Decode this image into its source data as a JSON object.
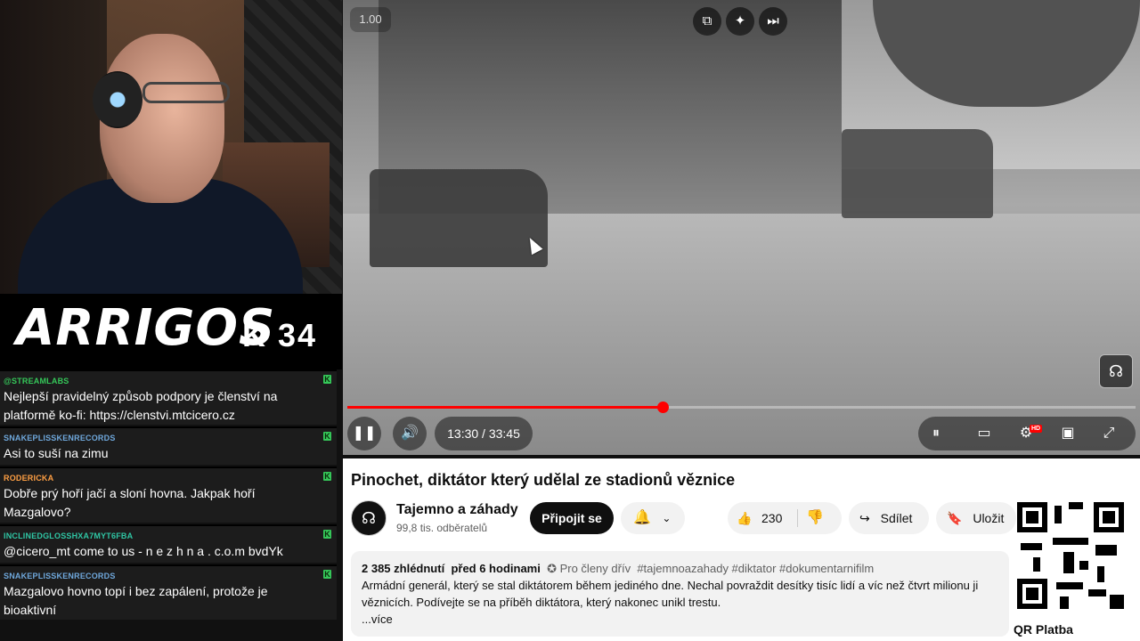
{
  "stream": {
    "brand_logo": "ARRIGOS",
    "brand_code": "K 34"
  },
  "chat": [
    {
      "user": "@STREAMLABS",
      "user_color": "#35c759",
      "text": "Nejlepší pravidelný způsob podpory je členství na platformě ko-fi: https://clenstvi.mtcicero.cz"
    },
    {
      "user": "SNAKEPLISSKENRECORDS",
      "user_color": "#6fa8dc",
      "text": "Asi to suší na zimu"
    },
    {
      "user": "RODERICKA",
      "user_color": "#ff9f43",
      "text": "Dobře prý hoří jačí a sloní hovna. Jakpak hoří Mazgalovo?"
    },
    {
      "user": "INCLINEDGLOSSHXA7MYT6FBA",
      "user_color": "#2fc6a4",
      "text": "@cicero_mt come to us - n e z h n a . c.o.m bvdYk"
    },
    {
      "user": "SNAKEPLISSKENRECORDS",
      "user_color": "#6fa8dc",
      "text": "Mazgalovo hovno topí i bez zapálení, protože je bioaktivní"
    }
  ],
  "player": {
    "speed": "1.00",
    "time": "13:30 / 33:45",
    "progress": 0.4,
    "icons": {
      "miniplayer": "miniplayer-icon",
      "ai": "sparkle-icon",
      "next": "next-icon",
      "pause": "pause-icon",
      "volume": "volume-icon",
      "autoplay": "autoplay-toggle-icon",
      "subtitles": "subtitles-icon",
      "settings": "settings-icon",
      "theater": "theater-icon",
      "fullscreen": "fullscreen-icon"
    },
    "hd_badge": "HD"
  },
  "video": {
    "title": "Pinochet, diktátor který udělal ze stadionů věznice",
    "channel_name": "Tajemno a záhady",
    "subscribers": "99,8 tis. odběratelů",
    "join_label": "Připojit se",
    "likes": "230",
    "share_label": "Sdílet",
    "save_label": "Uložit",
    "views": "2 385 zhlédnutí",
    "age": "před 6 hodinami",
    "members_label": "Pro členy dřív",
    "tags": "#tajemnoazahady #diktator #dokumentarnifilm",
    "description": "Armádní generál, který se stal diktátorem během jediného dne. Nechal povraždit desítky tisíc lidí a víc než čtvrt milionu ji věznicích. Podívejte se na příběh diktátora, který nakonec unikl trestu.",
    "more_label": "...více"
  },
  "overlay": {
    "qr_label": "QR Platba"
  }
}
